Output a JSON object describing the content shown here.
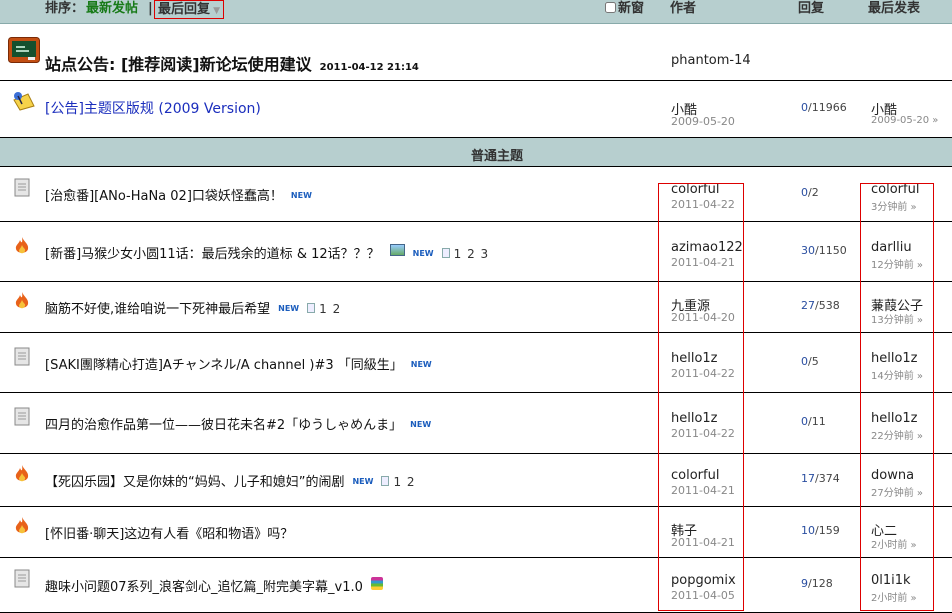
{
  "header": {
    "sort_label": "排序：",
    "sort_newest": "最新发帖",
    "sort_sep": "|",
    "sort_last_reply": "最后回复",
    "new_window": "新窗",
    "col_author": "作者",
    "col_replies": "回复",
    "col_last_post": "最后发表"
  },
  "announcement": {
    "title": "站点公告: [推荐阅读]新论坛使用建议",
    "date": "2011-04-12 21:14",
    "author": "phantom-14"
  },
  "rules": {
    "title": "[公告]主题区版规 (2009 Version)",
    "author": "小酷",
    "author_date": "2009-05-20",
    "replies": "0",
    "views": "/11966",
    "last_user": "小酷",
    "last_time": "2009-05-20 »"
  },
  "section_label": "普通主题",
  "new_tag": "NEW",
  "threads": [
    {
      "title": "[治愈番][ANo-HaNa 02]口袋妖怪蠢高！",
      "pages": "",
      "author": "colorful",
      "date": "2011-04-22",
      "replies": "0",
      "views": "/2",
      "last_user": "colorful",
      "last_time": "3分钟前 »"
    },
    {
      "title": "[新番]马猴少女小圆11话：最后残余的道标 & 12话？？？",
      "pages": "1 2 3",
      "author": "azimao122",
      "date": "2011-04-21",
      "replies": "30",
      "views": "/1150",
      "last_user": "darlliu",
      "last_time": "12分钟前 »"
    },
    {
      "title": "脑筋不好使,谁给咱说一下死神最后希望",
      "pages": "1 2",
      "author": "九重源",
      "date": "2011-04-20",
      "replies": "27",
      "views": "/538",
      "last_user": "蒹葭公子",
      "last_time": "13分钟前 »"
    },
    {
      "title": "[SAKI團隊精心打造]Aチャンネル/A channel )#3 「同級生」",
      "pages": "",
      "author": "hello1z",
      "date": "2011-04-22",
      "replies": "0",
      "views": "/5",
      "last_user": "hello1z",
      "last_time": "14分钟前 »"
    },
    {
      "title": "四月的治愈作品第一位——彼日花未名#2「ゆうしゃめんま」",
      "pages": "",
      "author": "hello1z",
      "date": "2011-04-22",
      "replies": "0",
      "views": "/11",
      "last_user": "hello1z",
      "last_time": "22分钟前 »"
    },
    {
      "title": "【死囚乐园】又是你妹的“妈妈、儿子和媳妇”的闹剧",
      "pages": "1 2",
      "author": "colorful",
      "date": "2011-04-21",
      "replies": "17",
      "views": "/374",
      "last_user": "downa",
      "last_time": "27分钟前 »"
    },
    {
      "title": "[怀旧番·聊天]这边有人看《昭和物语》吗？",
      "pages": "",
      "author": "韩子",
      "date": "2011-04-21",
      "replies": "10",
      "views": "/159",
      "last_user": "心二",
      "last_time": "2小时前 »"
    },
    {
      "title": "趣味小问题07系列_浪客剑心_追忆篇_附完美字幕_v1.0",
      "pages": "",
      "author": "popgomix",
      "date": "2011-04-05",
      "replies": "9",
      "views": "/128",
      "last_user": "0l1i1k",
      "last_time": "2小时前 »"
    }
  ],
  "colors": {
    "header_bg": "#b7cfcf",
    "highlight_border": "#dd0000",
    "link": "#1b2ebd",
    "replies_num": "#2a4ea0"
  },
  "icons": {
    "announcement": "blackboard-icon",
    "rules": "pin-notice-icon",
    "normal": "document-icon",
    "hot": "flame-icon"
  }
}
